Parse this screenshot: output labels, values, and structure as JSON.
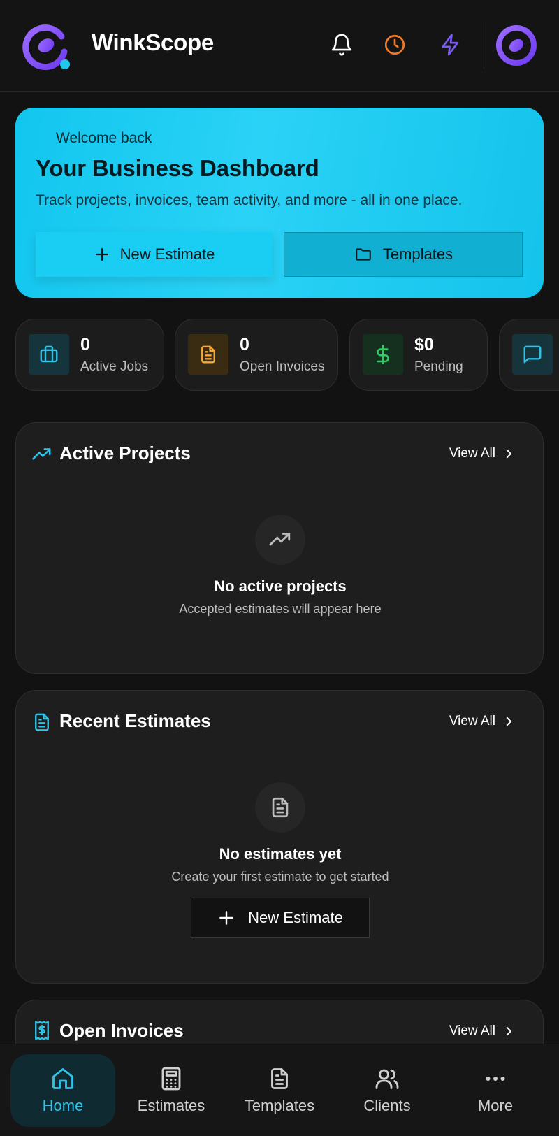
{
  "app": {
    "title": "WinkScope",
    "brand_color": "#8b5cf6",
    "accent_color": "#22c7ee"
  },
  "header": {
    "icons": [
      "bell-icon",
      "clock-icon",
      "lightning-icon"
    ]
  },
  "hero": {
    "eyebrow": "Welcome back",
    "title": "Your Business Dashboard",
    "subtitle": "Track projects, invoices, team activity, and more - all in one place.",
    "primary_button": "New Estimate",
    "secondary_button": "Templates"
  },
  "stats": [
    {
      "value": "0",
      "label": "Active Jobs",
      "icon": "briefcase-icon"
    },
    {
      "value": "0",
      "label": "Open Invoices",
      "icon": "document-icon"
    },
    {
      "value": "$0",
      "label": "Pending",
      "icon": "dollar-icon"
    },
    {
      "icon": "chat-icon"
    }
  ],
  "cards": {
    "active_projects": {
      "title": "Active Projects",
      "link": "View All",
      "empty_title": "No active projects",
      "empty_subtitle": "Accepted estimates will appear here"
    },
    "recent_estimates": {
      "title": "Recent Estimates",
      "link": "View All",
      "empty_title": "No estimates yet",
      "empty_subtitle": "Create your first estimate to get started",
      "button": "New Estimate"
    },
    "open_invoices": {
      "title": "Open Invoices",
      "link": "View All"
    }
  },
  "nav": {
    "items": [
      {
        "label": "Home",
        "icon": "home-icon",
        "active": true
      },
      {
        "label": "Estimates",
        "icon": "calculator-icon",
        "active": false
      },
      {
        "label": "Templates",
        "icon": "document-icon",
        "active": false
      },
      {
        "label": "Clients",
        "icon": "users-icon",
        "active": false
      },
      {
        "label": "More",
        "icon": "more-icon",
        "active": false
      }
    ]
  }
}
